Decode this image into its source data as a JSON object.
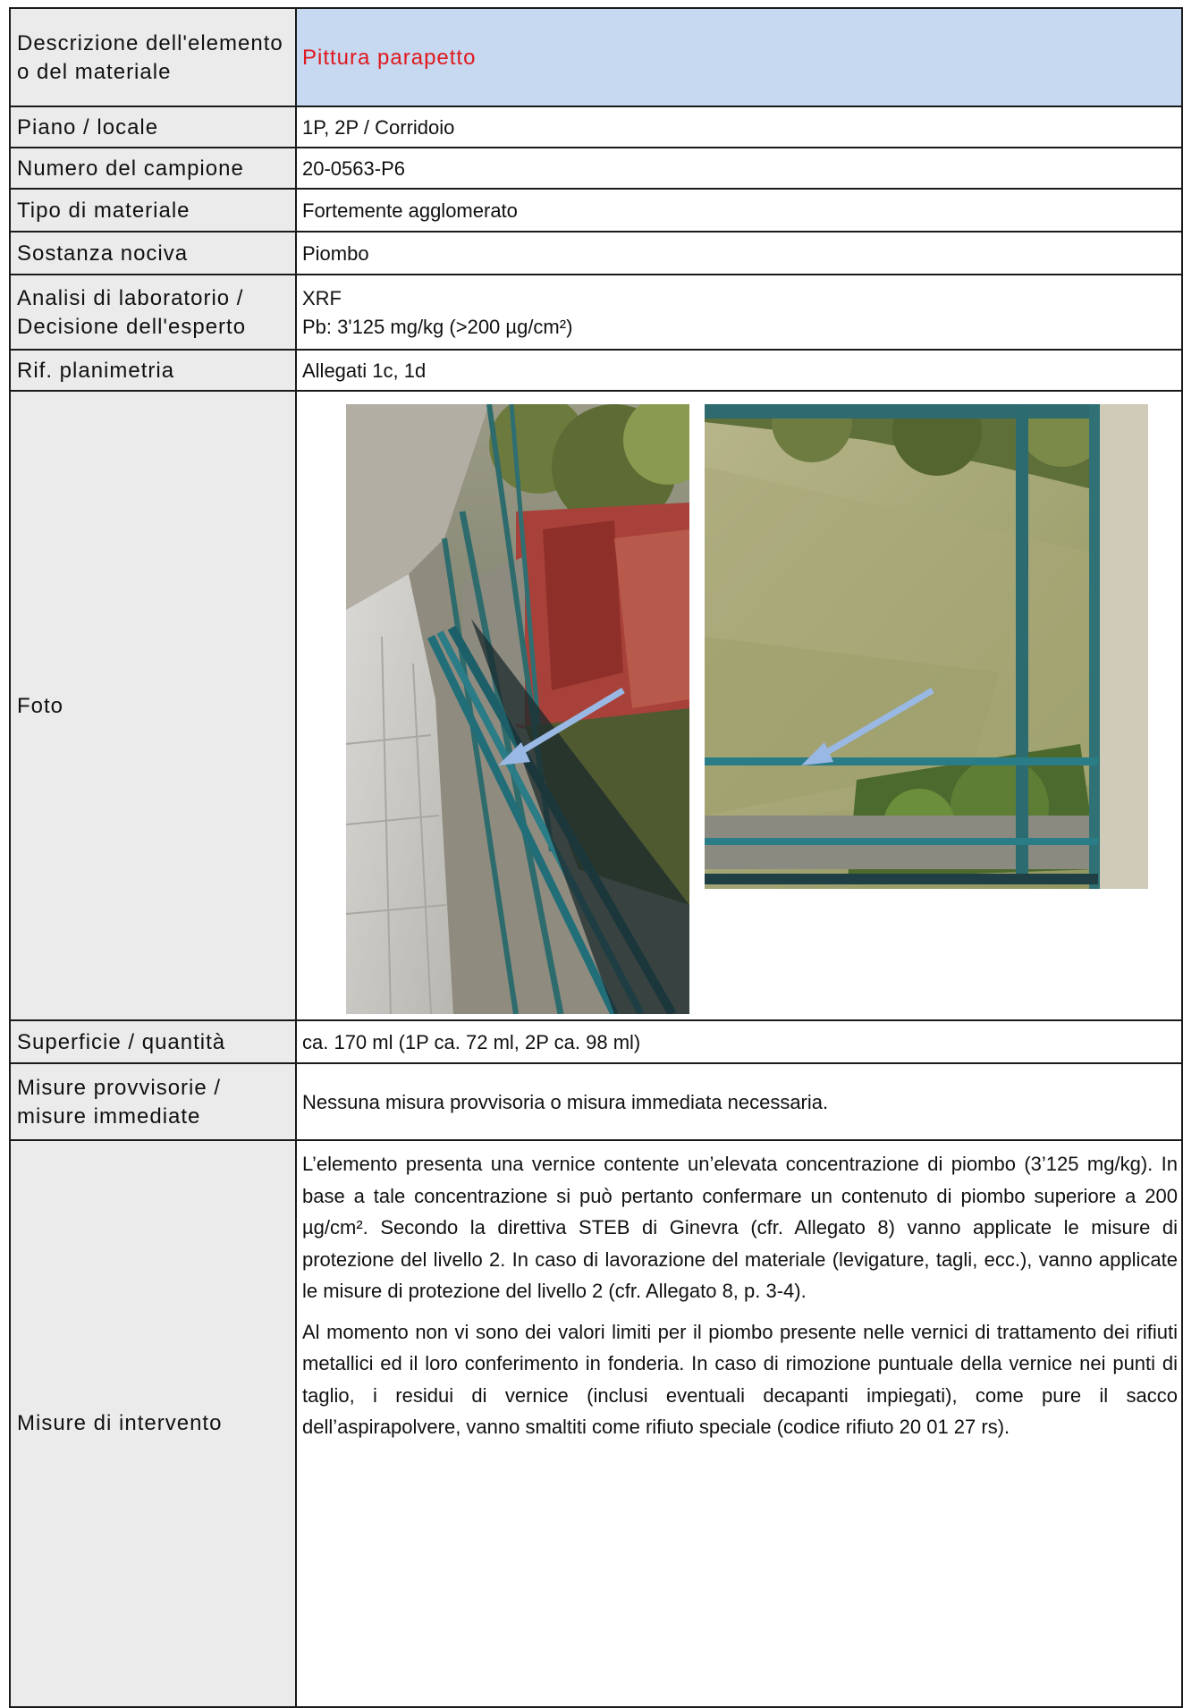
{
  "rows": {
    "descrizione": {
      "label": "Descrizione dell'elemento o del materiale",
      "value": "Pittura parapetto"
    },
    "piano": {
      "label": "Piano / locale",
      "value": "1P, 2P / Corridoio"
    },
    "numero": {
      "label": "Numero del campione",
      "value": "20-0563-P6"
    },
    "tipo": {
      "label": "Tipo di materiale",
      "value": "Fortemente agglomerato"
    },
    "sostanza": {
      "label": "Sostanza nociva",
      "value": "Piombo"
    },
    "analisi": {
      "label": "Analisi di laboratorio / Decisione dell'esperto",
      "value_line1": "XRF",
      "value_line2": "Pb: 3'125 mg/kg (>200 µg/cm²)"
    },
    "rif": {
      "label": "Rif. planimetria",
      "value": "Allegati 1c, 1d"
    },
    "foto": {
      "label": "Foto"
    },
    "superficie": {
      "label": "Superficie / quantità",
      "value": "ca. 170 ml (1P ca. 72 ml, 2P ca. 98 ml)"
    },
    "provvisorie": {
      "label": "Misure provvisorie / misure immediate",
      "value": "Nessuna misura provvisoria o misura immediata necessaria."
    },
    "intervento": {
      "label": "Misure di intervento",
      "paragraph1": "L’elemento presenta una vernice contente un’elevata concentrazione di piombo (3’125 mg/kg). In base a tale concentrazione si può pertanto confermare un contenuto di piombo superiore a 200 µg/cm². Secondo la direttiva STEB di Ginevra (cfr. Allegato 8) vanno applicate le misure di protezione del livello 2. In caso di lavorazione del materiale (levigature, tagli, ecc.), vanno applicate le misure di protezione del livello 2 (cfr. Allegato 8, p. 3-4).",
      "paragraph2": "Al momento non vi sono dei valori limiti per il piombo presente nelle vernici di trattamento dei rifiuti metallici ed il loro conferimento in fonderia. In caso di rimozione puntuale della vernice nei punti di taglio, i residui di vernice (inclusi eventuali decapanti impiegati), come pure il sacco dell’aspirapolvere, vanno smaltiti come rifiuto speciale (codice rifiuto 20 01 27 rs)."
    }
  },
  "colors": {
    "highlight_bg": "#c6d9f0",
    "label_bg": "#ebebeb",
    "title_red": "#e0181e",
    "arrow": "#9ab8e4"
  }
}
